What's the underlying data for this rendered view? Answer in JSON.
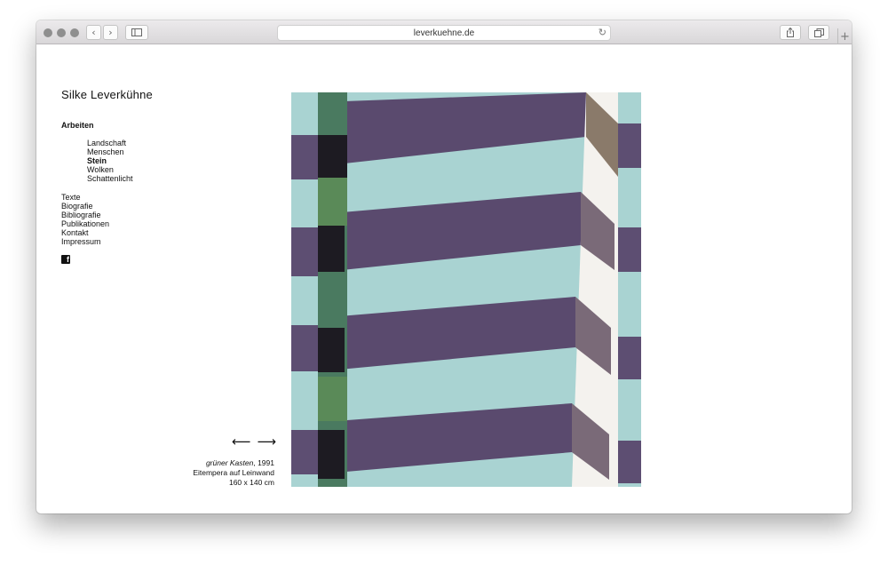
{
  "browser": {
    "url": "leverkuehne.de",
    "back_icon": "‹",
    "forward_icon": "›",
    "reload_icon": "↻"
  },
  "site": {
    "title": "Silke Leverkühne"
  },
  "nav": {
    "section": "Arbeiten",
    "subitems": [
      "Landschaft",
      "Menschen",
      "Stein",
      "Wolken",
      "Schattenlicht"
    ],
    "active_subitem": "Stein",
    "items": [
      "Texte",
      "Biografie",
      "Bibliografie",
      "Publikationen",
      "Kontakt",
      "Impressum"
    ]
  },
  "artwork": {
    "title": "grüner Kasten",
    "year": ", 1991",
    "technique": "Eitempera auf Leinwand",
    "size": "160 x 140 cm",
    "prev_arrow": "⟵",
    "next_arrow": "⟶"
  },
  "colors": {
    "purple": "#5a4a6e",
    "aqua": "#a9d3d2",
    "green": "#4a7a60",
    "black": "#1d1b22",
    "white": "#f4f2ee",
    "ochre": "#8a7a6a"
  }
}
